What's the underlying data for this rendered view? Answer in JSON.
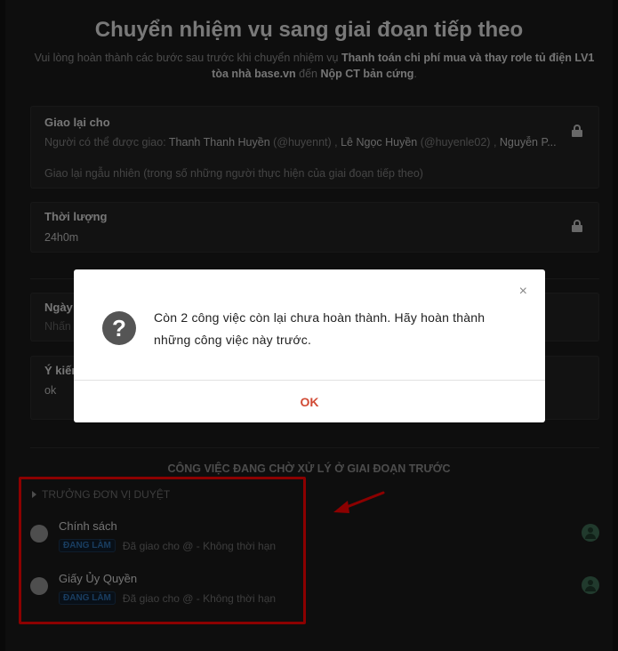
{
  "header": {
    "title": "Chuyển nhiệm vụ sang giai đoạn tiếp theo",
    "subtitle_prefix": "Vui lòng hoàn thành các bước sau trước khi chuyển nhiệm vụ",
    "task_name": "Thanh toán chi phí mua và thay rơle tủ điện LV1 tòa nhà base.vn",
    "subtitle_mid": "đến",
    "stage_name": "Nộp CT bản cứng",
    "subtitle_end": "."
  },
  "reassign": {
    "label": "Giao lại cho",
    "people_prefix": "Người có thể được giao:",
    "people": [
      {
        "name": "Thanh Thanh Huyền",
        "handle": "(@huyennt)"
      },
      {
        "name": "Lê Ngọc Huyền",
        "handle": "(@huyenle02)"
      },
      {
        "name": "Nguyễn P...",
        "handle": ""
      }
    ],
    "random_note": "Giao lại ngẫu nhiên (trong số những người thực hiện của giai đoạn tiếp theo)"
  },
  "duration": {
    "label": "Thời lượng",
    "value": "24h0m"
  },
  "date_field": {
    "label": "Ngày c",
    "placeholder": "Nhấn c"
  },
  "opinion": {
    "label": "Ý kiến",
    "value": "ok"
  },
  "pending": {
    "section_title": "CÔNG VIỆC ĐANG CHỜ XỬ LÝ Ở GIAI ĐOẠN TRƯỚC",
    "group_header": "TRƯỞNG ĐƠN VỊ DUYỆT",
    "tasks": [
      {
        "name": "Chính sách",
        "status": "ĐANG LÀM",
        "note": "Đã giao cho @ - Không thời hạn"
      },
      {
        "name": "Giấy Ủy Quyền",
        "status": "ĐANG LÀM",
        "note": "Đã giao cho @ - Không thời hạn"
      }
    ]
  },
  "modal": {
    "close_glyph": "×",
    "icon_glyph": "?",
    "message": "Còn 2 công việc còn lại chưa hoàn thành. Hãy hoàn thành những công việc này trước.",
    "ok_label": "OK"
  },
  "colors": {
    "annotation_red": "#ff0000",
    "ok_color": "#d14b35",
    "badge_blue": "#2f6fb0",
    "avatar_green": "#3d6a52"
  },
  "icons": {
    "lock": "lock-icon",
    "question": "question-icon",
    "close": "close-icon",
    "avatar": "user-avatar-icon",
    "caret": "caret-right-icon"
  }
}
